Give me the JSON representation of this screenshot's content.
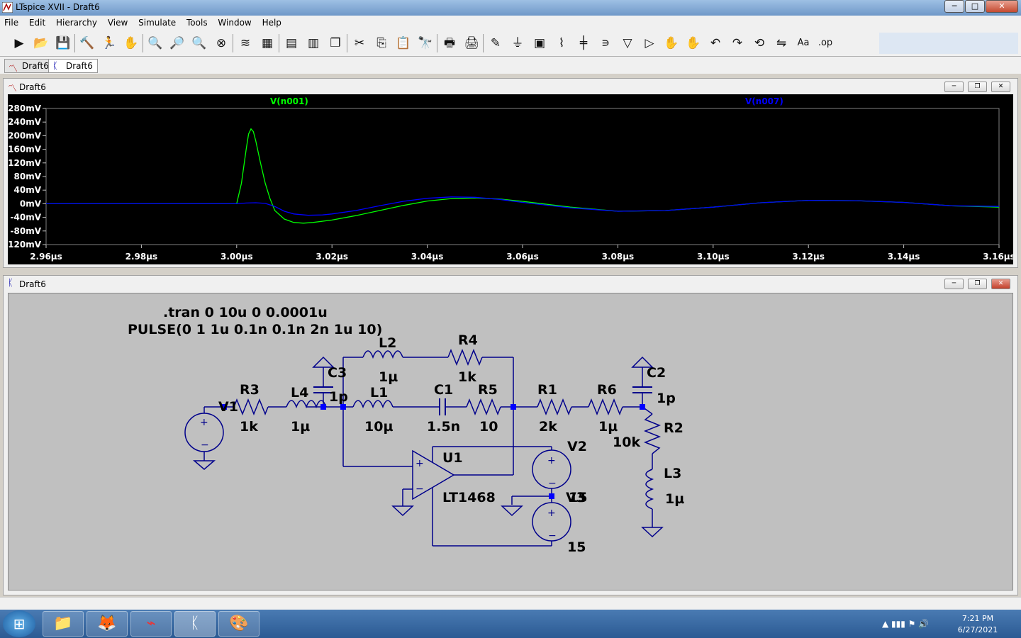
{
  "window": {
    "title": "LTspice XVII - Draft6",
    "min": "─",
    "max": "□",
    "close": "✕"
  },
  "menu": [
    "File",
    "Edit",
    "Hierarchy",
    "View",
    "Simulate",
    "Tools",
    "Window",
    "Help"
  ],
  "toolbar": {
    "icons": [
      "run-icon",
      "open-icon",
      "save-icon",
      "control-panel-icon",
      "halt-icon",
      "pan-icon",
      "zoom-in-icon",
      "zoom-area-icon",
      "zoom-out-icon",
      "zoom-cancel-icon",
      "autorange-icon",
      "tile-icon",
      "tile-horizontal-icon",
      "tile-vertical-icon",
      "cascade-icon",
      "cut-icon",
      "copy-icon",
      "paste-icon",
      "find-icon",
      "print-icon",
      "print-setup-icon",
      "wire-icon",
      "ground-icon",
      "label-icon",
      "resistor-icon",
      "capacitor-icon",
      "inductor-icon",
      "diode-icon",
      "component-icon",
      "move-icon",
      "drag-icon",
      "undo-icon",
      "redo-icon",
      "rotate-icon",
      "mirror-icon",
      "text-icon",
      "spice-directive-icon"
    ],
    "glyphs": [
      "▶",
      "📂",
      "💾",
      "🔨",
      "🏃",
      "✋",
      "🔍",
      "🔎",
      "🔍",
      "⊗",
      "≋",
      "▦",
      "▤",
      "▥",
      "❐",
      "✂",
      "⎘",
      "📋",
      "🔭",
      "🖶",
      "🖨",
      "✎",
      "⏚",
      "▣",
      "⌇",
      "╪",
      "∍",
      "▽",
      "▷",
      "✋",
      "✋",
      "↶",
      "↷",
      "⟲",
      "⇋",
      "Aa",
      ".op"
    ]
  },
  "doc_tabs": [
    {
      "label": "Draft6",
      "icon": "waveform-icon",
      "glyph": "〽",
      "active": false
    },
    {
      "label": "Draft6",
      "icon": "schematic-icon",
      "glyph": "ᛕ",
      "active": true
    }
  ],
  "waveform": {
    "title": "Draft6",
    "trace_labels": [
      {
        "name": "V(n001)",
        "color": "#00ff00"
      },
      {
        "name": "V(n007)",
        "color": "#0000ff"
      }
    ]
  },
  "chart_data": {
    "type": "line",
    "xlabel": "",
    "ylabel": "",
    "x_ticks": [
      "2.96µs",
      "2.98µs",
      "3.00µs",
      "3.02µs",
      "3.04µs",
      "3.06µs",
      "3.08µs",
      "3.10µs",
      "3.12µs",
      "3.14µs",
      "3.16µs"
    ],
    "y_ticks": [
      "280mV",
      "240mV",
      "200mV",
      "160mV",
      "120mV",
      "80mV",
      "40mV",
      "0mV",
      "-40mV",
      "-80mV",
      "-120mV"
    ],
    "xlim": [
      2.96,
      3.16
    ],
    "ylim": [
      -120,
      280
    ],
    "x_unit": "µs",
    "y_unit": "mV",
    "series": [
      {
        "name": "V(n001)",
        "color": "#00ff00",
        "x": [
          2.96,
          3.0,
          3.001,
          3.002,
          3.0025,
          3.003,
          3.0035,
          3.004,
          3.005,
          3.006,
          3.007,
          3.008,
          3.01,
          3.012,
          3.014,
          3.016,
          3.02,
          3.025,
          3.03,
          3.035,
          3.04,
          3.045,
          3.05,
          3.055,
          3.06,
          3.07,
          3.08,
          3.09,
          3.1,
          3.11,
          3.12,
          3.13,
          3.14,
          3.15,
          3.16
        ],
        "y": [
          0,
          0,
          60,
          160,
          205,
          220,
          212,
          185,
          120,
          60,
          15,
          -20,
          -45,
          -55,
          -57,
          -55,
          -48,
          -35,
          -20,
          -5,
          8,
          15,
          17,
          14,
          7,
          -10,
          -22,
          -20,
          -10,
          3,
          10,
          9,
          4,
          -6,
          -10
        ]
      },
      {
        "name": "V(n007)",
        "color": "#0000ff",
        "x": [
          2.96,
          3.0,
          3.002,
          3.004,
          3.006,
          3.008,
          3.01,
          3.012,
          3.015,
          3.018,
          3.02,
          3.025,
          3.03,
          3.035,
          3.04,
          3.045,
          3.05,
          3.055,
          3.06,
          3.07,
          3.08,
          3.09,
          3.1,
          3.11,
          3.12,
          3.13,
          3.14,
          3.15,
          3.16
        ],
        "y": [
          0,
          0,
          2,
          3,
          1,
          -8,
          -22,
          -30,
          -34,
          -33,
          -30,
          -20,
          -6,
          7,
          16,
          20,
          19,
          13,
          4,
          -12,
          -22,
          -20,
          -10,
          3,
          10,
          9,
          4,
          -6,
          -8
        ]
      }
    ]
  },
  "schematic": {
    "title": "Draft6",
    "directives": [
      ".tran 0 10u 0 0.0001u",
      "PULSE(0 1 1u 0.1n 0.1n 2n 1u 10)"
    ],
    "labels": {
      "V1": "V1",
      "R3": "R3",
      "R3v": "1k",
      "L4": "L4",
      "L4v": "1µ",
      "C3": "C3",
      "C3v": "1p",
      "L1": "L1",
      "L1v": "10µ",
      "L2": "L2",
      "L2v": "1µ",
      "R4": "R4",
      "R4v": "1k",
      "C1": "C1",
      "C1v": "1.5n",
      "R5": "R5",
      "R5v": "10",
      "R1": "R1",
      "R1v": "2k",
      "R6": "R6",
      "R6v": "1µ",
      "C2": "C2",
      "C2v": "1p",
      "R2": "R2",
      "R2v": "10k",
      "L3": "L3",
      "L3v": "1µ",
      "U1": "U1",
      "U1model": "LT1468",
      "V2": "V2",
      "V3": "V3",
      "V3v": "15",
      "V15": "15"
    }
  },
  "taskbar": {
    "apps": [
      {
        "name": "explorer-icon",
        "glyph": "📁"
      },
      {
        "name": "firefox-icon",
        "glyph": "🦊"
      },
      {
        "name": "acrobat-icon",
        "glyph": "⌁"
      },
      {
        "name": "ltspice-icon",
        "glyph": "ᛕ"
      },
      {
        "name": "paint-icon",
        "glyph": "🎨"
      }
    ],
    "tray_icons": "▲  ▮▮▮  ⚑  🔊",
    "time": "7:21 PM",
    "date": "6/27/2021"
  }
}
